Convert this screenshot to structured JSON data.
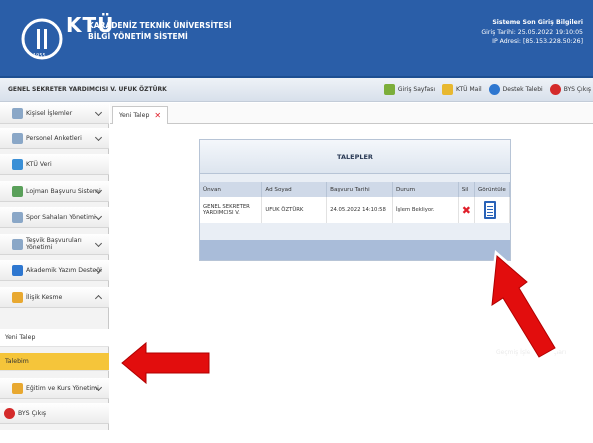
{
  "header": {
    "logo_text": "KTÜ",
    "logo_sub": "1955",
    "uni_line1": "KARADENİZ TEKNİK ÜNİVERSİTESİ",
    "uni_line2": "BİLGİ YÖNETİM SİSTEMİ",
    "login_title": "Sisteme Son Giriş Bilgileri",
    "login_date": "Giriş Tarihi: 25.05.2022 19:10:05",
    "login_ip": "IP Adresi: [85.153.228.50:26]"
  },
  "userbar": {
    "user": "GENEL SEKRETER YARDIMCISI V. UFUK ÖZTÜRK",
    "links": [
      {
        "label": "Giriş Sayfası",
        "icon": "home-icon",
        "color": "#7cae3a"
      },
      {
        "label": "KTÜ Mail",
        "icon": "mail-icon",
        "color": "#e8b830"
      },
      {
        "label": "Destek Talebi",
        "icon": "help-icon",
        "color": "#2e77d0"
      },
      {
        "label": "BYS Çıkış",
        "icon": "logout-icon",
        "color": "#d42a2a"
      }
    ]
  },
  "sidebar": {
    "items": [
      {
        "label": "Kişisel İşlemler",
        "icon": "person-card-icon",
        "color": "#8aa7c7"
      },
      {
        "label": "Personel Anketleri",
        "icon": "survey-icon",
        "color": "#8aa7c7"
      },
      {
        "label": "KTÜ Veri",
        "icon": "data-icon",
        "color": "#3a8fd6"
      },
      {
        "label": "Lojman Başvuru Sistemi",
        "icon": "house-icon",
        "color": "#5aa05a"
      },
      {
        "label": "Spor Sahaları Yönetimi",
        "icon": "sports-icon",
        "color": "#8aa7c7"
      },
      {
        "label": "Teşvik Başvuruları Yönetimi",
        "icon": "incentive-icon",
        "color": "#8aa7c7"
      },
      {
        "label": "Akademik Yazım Desteği",
        "icon": "writing-icon",
        "color": "#2e77d0"
      },
      {
        "label": "İlişik Kesme",
        "icon": "disconnect-icon",
        "color": "#e8a830"
      }
    ],
    "subitems": [
      {
        "label": "Yeni Talep"
      },
      {
        "label": "Talebim"
      }
    ],
    "bottom": [
      {
        "label": "Eğitim ve Kurs Yönetimi",
        "icon": "education-icon",
        "color": "#e8a830"
      },
      {
        "label": "BYS Çıkış",
        "icon": "logout-icon",
        "color": "#d42a2a"
      }
    ]
  },
  "tab": {
    "label": "Yeni Talep",
    "close": "✕"
  },
  "panel": {
    "title": "TALEPLER",
    "columns": [
      "Ünvan",
      "Ad Soyad",
      "Başvuru Tarihi",
      "Durum",
      "Sil",
      "Görüntüle"
    ],
    "rows": [
      {
        "unvan_1": "GENEL SEKRETER",
        "unvan_2": "YARDIMCISI V.",
        "ad_soyad": "UFUK ÖZTÜRK",
        "tarih": "24.05.2022 14:10:58",
        "durum": "İşlem Bekliyor.",
        "sil": "✖"
      }
    ]
  },
  "faded_text": "Geçmiş İşlem Sonuçları"
}
